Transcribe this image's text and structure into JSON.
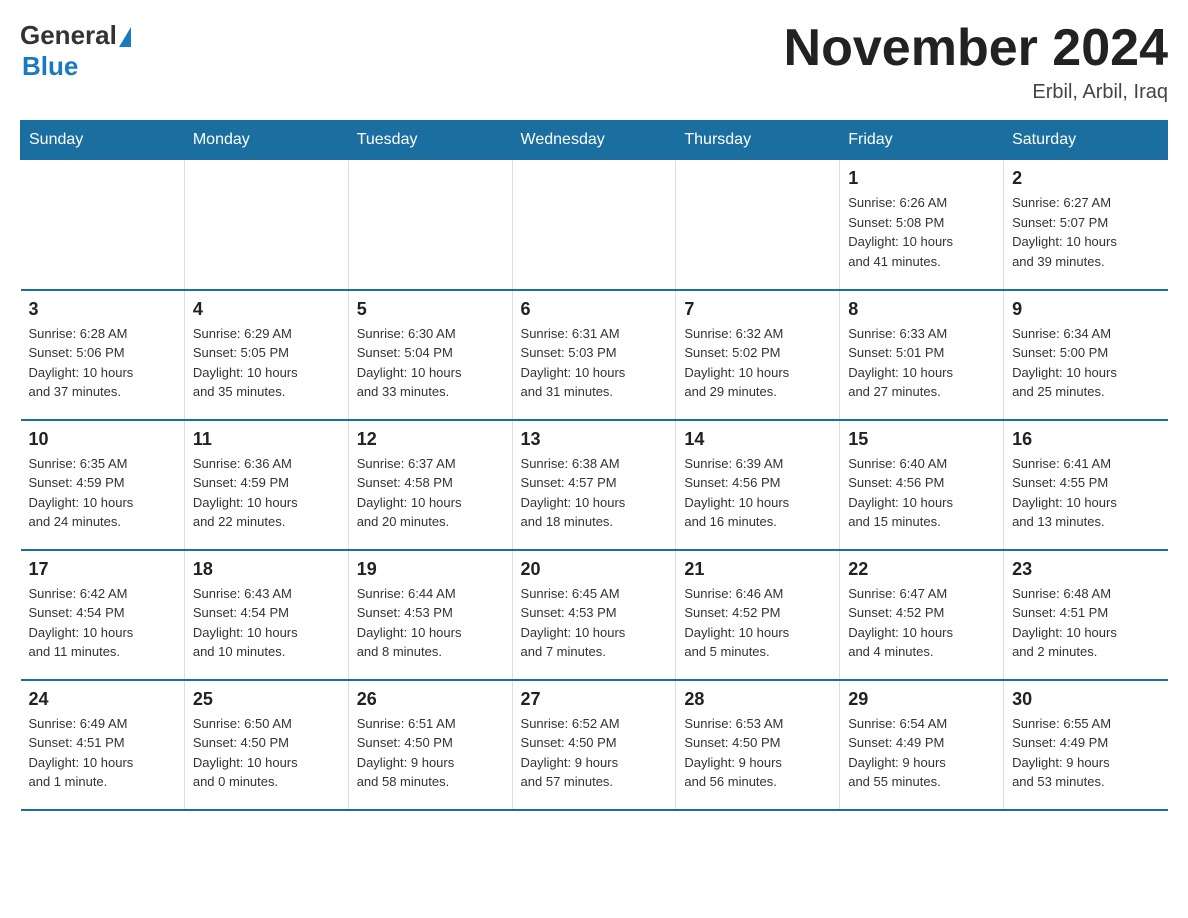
{
  "header": {
    "logo_general": "General",
    "logo_blue": "Blue",
    "title": "November 2024",
    "subtitle": "Erbil, Arbil, Iraq"
  },
  "days_of_week": [
    "Sunday",
    "Monday",
    "Tuesday",
    "Wednesday",
    "Thursday",
    "Friday",
    "Saturday"
  ],
  "weeks": [
    [
      {
        "day": "",
        "info": ""
      },
      {
        "day": "",
        "info": ""
      },
      {
        "day": "",
        "info": ""
      },
      {
        "day": "",
        "info": ""
      },
      {
        "day": "",
        "info": ""
      },
      {
        "day": "1",
        "info": "Sunrise: 6:26 AM\nSunset: 5:08 PM\nDaylight: 10 hours\nand 41 minutes."
      },
      {
        "day": "2",
        "info": "Sunrise: 6:27 AM\nSunset: 5:07 PM\nDaylight: 10 hours\nand 39 minutes."
      }
    ],
    [
      {
        "day": "3",
        "info": "Sunrise: 6:28 AM\nSunset: 5:06 PM\nDaylight: 10 hours\nand 37 minutes."
      },
      {
        "day": "4",
        "info": "Sunrise: 6:29 AM\nSunset: 5:05 PM\nDaylight: 10 hours\nand 35 minutes."
      },
      {
        "day": "5",
        "info": "Sunrise: 6:30 AM\nSunset: 5:04 PM\nDaylight: 10 hours\nand 33 minutes."
      },
      {
        "day": "6",
        "info": "Sunrise: 6:31 AM\nSunset: 5:03 PM\nDaylight: 10 hours\nand 31 minutes."
      },
      {
        "day": "7",
        "info": "Sunrise: 6:32 AM\nSunset: 5:02 PM\nDaylight: 10 hours\nand 29 minutes."
      },
      {
        "day": "8",
        "info": "Sunrise: 6:33 AM\nSunset: 5:01 PM\nDaylight: 10 hours\nand 27 minutes."
      },
      {
        "day": "9",
        "info": "Sunrise: 6:34 AM\nSunset: 5:00 PM\nDaylight: 10 hours\nand 25 minutes."
      }
    ],
    [
      {
        "day": "10",
        "info": "Sunrise: 6:35 AM\nSunset: 4:59 PM\nDaylight: 10 hours\nand 24 minutes."
      },
      {
        "day": "11",
        "info": "Sunrise: 6:36 AM\nSunset: 4:59 PM\nDaylight: 10 hours\nand 22 minutes."
      },
      {
        "day": "12",
        "info": "Sunrise: 6:37 AM\nSunset: 4:58 PM\nDaylight: 10 hours\nand 20 minutes."
      },
      {
        "day": "13",
        "info": "Sunrise: 6:38 AM\nSunset: 4:57 PM\nDaylight: 10 hours\nand 18 minutes."
      },
      {
        "day": "14",
        "info": "Sunrise: 6:39 AM\nSunset: 4:56 PM\nDaylight: 10 hours\nand 16 minutes."
      },
      {
        "day": "15",
        "info": "Sunrise: 6:40 AM\nSunset: 4:56 PM\nDaylight: 10 hours\nand 15 minutes."
      },
      {
        "day": "16",
        "info": "Sunrise: 6:41 AM\nSunset: 4:55 PM\nDaylight: 10 hours\nand 13 minutes."
      }
    ],
    [
      {
        "day": "17",
        "info": "Sunrise: 6:42 AM\nSunset: 4:54 PM\nDaylight: 10 hours\nand 11 minutes."
      },
      {
        "day": "18",
        "info": "Sunrise: 6:43 AM\nSunset: 4:54 PM\nDaylight: 10 hours\nand 10 minutes."
      },
      {
        "day": "19",
        "info": "Sunrise: 6:44 AM\nSunset: 4:53 PM\nDaylight: 10 hours\nand 8 minutes."
      },
      {
        "day": "20",
        "info": "Sunrise: 6:45 AM\nSunset: 4:53 PM\nDaylight: 10 hours\nand 7 minutes."
      },
      {
        "day": "21",
        "info": "Sunrise: 6:46 AM\nSunset: 4:52 PM\nDaylight: 10 hours\nand 5 minutes."
      },
      {
        "day": "22",
        "info": "Sunrise: 6:47 AM\nSunset: 4:52 PM\nDaylight: 10 hours\nand 4 minutes."
      },
      {
        "day": "23",
        "info": "Sunrise: 6:48 AM\nSunset: 4:51 PM\nDaylight: 10 hours\nand 2 minutes."
      }
    ],
    [
      {
        "day": "24",
        "info": "Sunrise: 6:49 AM\nSunset: 4:51 PM\nDaylight: 10 hours\nand 1 minute."
      },
      {
        "day": "25",
        "info": "Sunrise: 6:50 AM\nSunset: 4:50 PM\nDaylight: 10 hours\nand 0 minutes."
      },
      {
        "day": "26",
        "info": "Sunrise: 6:51 AM\nSunset: 4:50 PM\nDaylight: 9 hours\nand 58 minutes."
      },
      {
        "day": "27",
        "info": "Sunrise: 6:52 AM\nSunset: 4:50 PM\nDaylight: 9 hours\nand 57 minutes."
      },
      {
        "day": "28",
        "info": "Sunrise: 6:53 AM\nSunset: 4:50 PM\nDaylight: 9 hours\nand 56 minutes."
      },
      {
        "day": "29",
        "info": "Sunrise: 6:54 AM\nSunset: 4:49 PM\nDaylight: 9 hours\nand 55 minutes."
      },
      {
        "day": "30",
        "info": "Sunrise: 6:55 AM\nSunset: 4:49 PM\nDaylight: 9 hours\nand 53 minutes."
      }
    ]
  ]
}
